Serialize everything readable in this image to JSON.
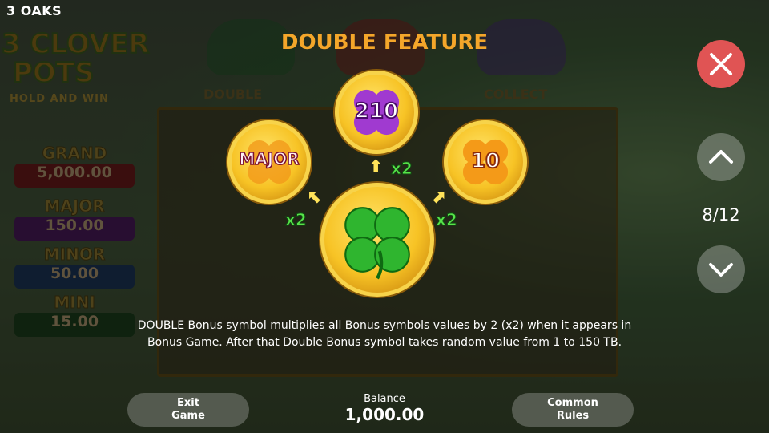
{
  "brand": "3 OAKS",
  "game_logo": {
    "line1": "3 CLOVER",
    "line2": "POTS",
    "tagline": "HOLD AND WIN"
  },
  "jackpots": [
    {
      "name": "GRAND",
      "value": "5,000.00",
      "color": "#8b1b1b"
    },
    {
      "name": "MAJOR",
      "value": "150.00",
      "color": "#5a1a6e"
    },
    {
      "name": "MINOR",
      "value": "50.00",
      "color": "#1c3d6e"
    },
    {
      "name": "MINI",
      "value": "15.00",
      "color": "#1f4a1f"
    }
  ],
  "pot_labels": [
    "DOUBLE",
    "COLLECT"
  ],
  "title": "DOUBLE FEATURE",
  "coins": {
    "left": "MAJOR",
    "top": "210",
    "right": "10"
  },
  "multipliers": {
    "left": "x2",
    "top": "x2",
    "right": "x2"
  },
  "description": "DOUBLE Bonus symbol multiplies all Bonus symbols values by 2 (x2) when it appears in Bonus Game. After that Double Bonus symbol takes random value from 1 to 150 TB.",
  "buttons": {
    "exit": "Exit Game",
    "rules": "Common Rules"
  },
  "balance": {
    "label": "Balance",
    "value": "1,000.00"
  },
  "pager": "8/12",
  "colors": {
    "close": "#e05454",
    "nav": "#d8d8d8",
    "title": "#f4a62a",
    "multiplier": "#57e34a"
  },
  "icons": [
    "close-icon",
    "chevron-up-icon",
    "chevron-down-icon",
    "clover-icon"
  ]
}
